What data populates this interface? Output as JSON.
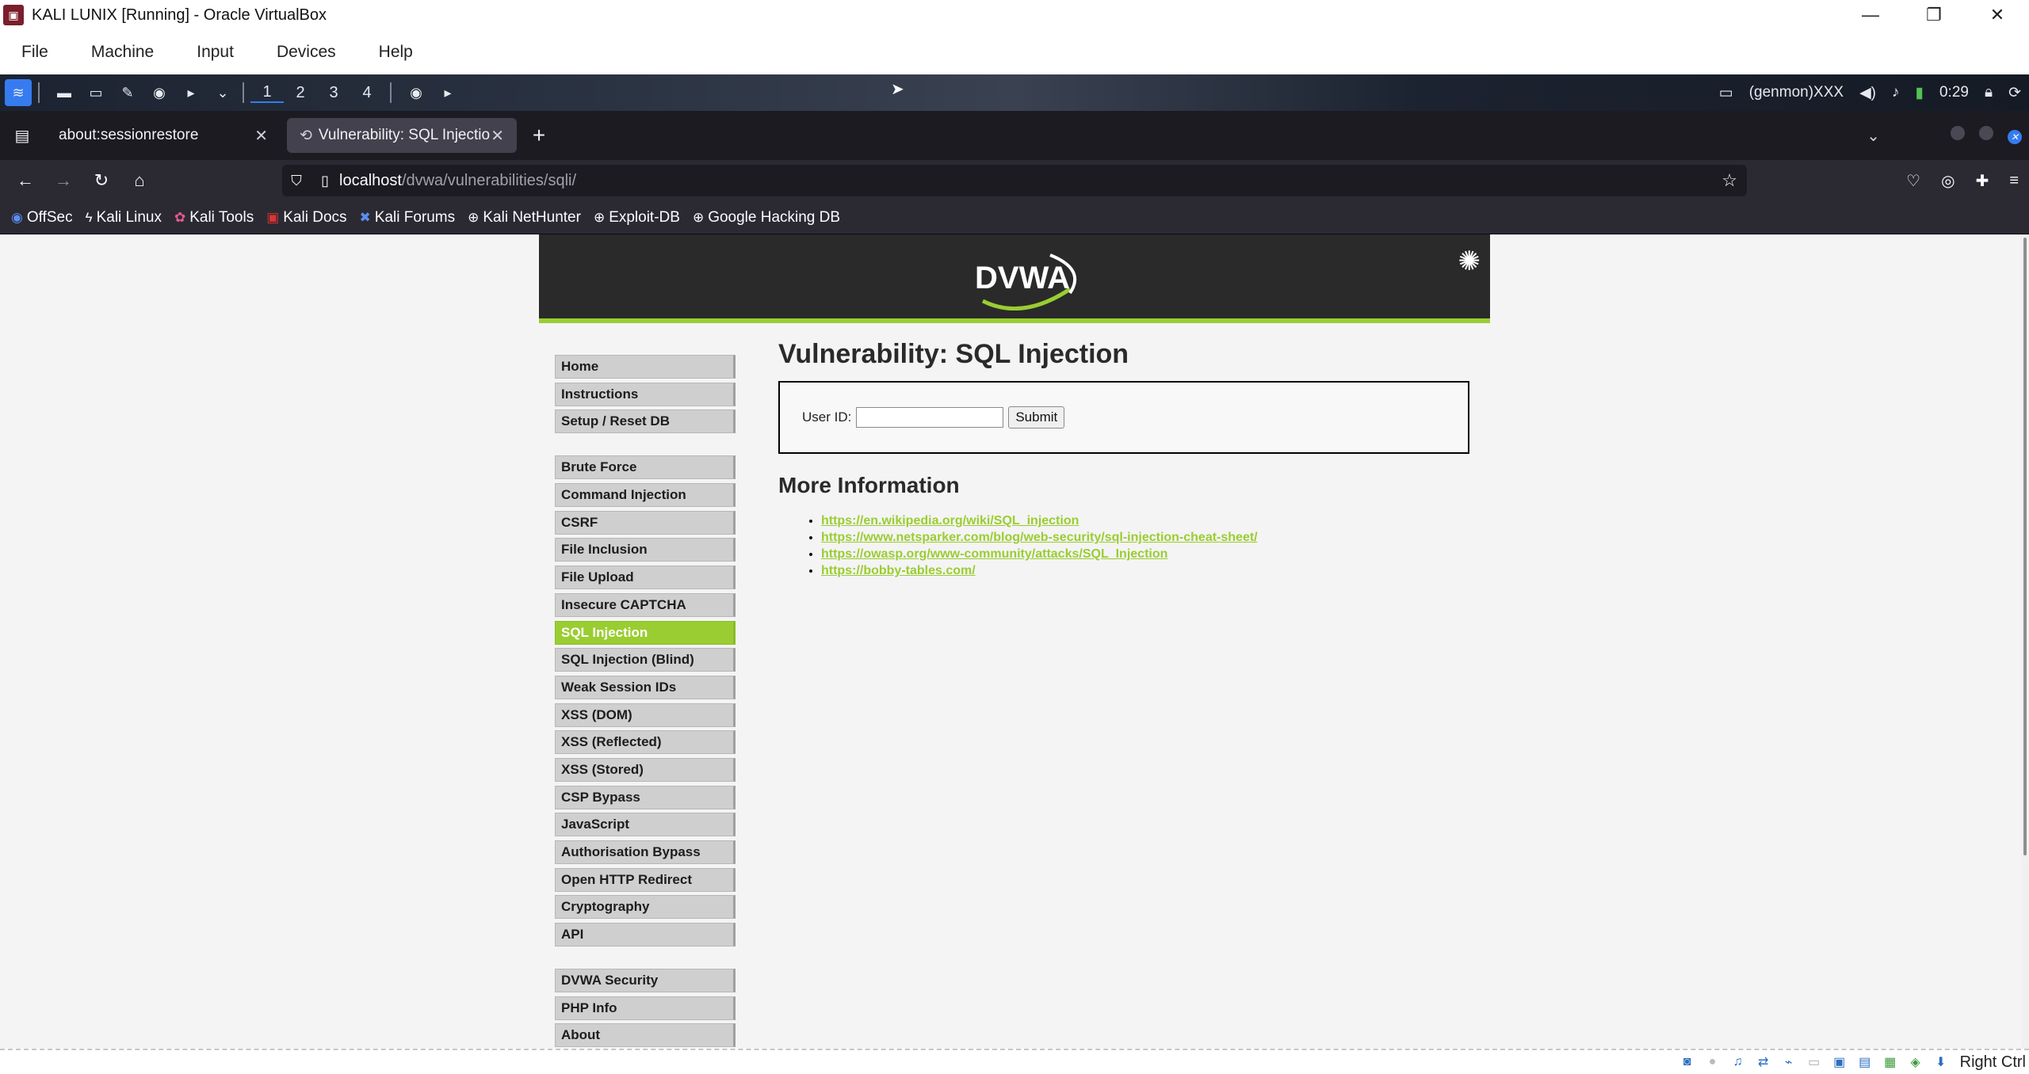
{
  "vbox": {
    "title": "KALI LUNIX [Running] - Oracle VirtualBox",
    "menu": [
      "File",
      "Machine",
      "Input",
      "Devices",
      "Help"
    ],
    "host_key": "Right Ctrl"
  },
  "kali_panel": {
    "workspaces": [
      "1",
      "2",
      "3",
      "4"
    ],
    "genmon": "(genmon)XXX",
    "clock": "0:29"
  },
  "browser": {
    "tabs": [
      {
        "label": "about:sessionrestore",
        "active": false
      },
      {
        "label": "Vulnerability: SQL Injectio",
        "active": true
      }
    ],
    "url_host": "localhost",
    "url_path": "/dvwa/vulnerabilities/sqli/",
    "bookmarks": [
      "OffSec",
      "Kali Linux",
      "Kali Tools",
      "Kali Docs",
      "Kali Forums",
      "Kali NetHunter",
      "Exploit-DB",
      "Google Hacking DB"
    ]
  },
  "dvwa": {
    "logo_text": "DVWA",
    "menu_groups": [
      [
        "Home",
        "Instructions",
        "Setup / Reset DB"
      ],
      [
        "Brute Force",
        "Command Injection",
        "CSRF",
        "File Inclusion",
        "File Upload",
        "Insecure CAPTCHA",
        "SQL Injection",
        "SQL Injection (Blind)",
        "Weak Session IDs",
        "XSS (DOM)",
        "XSS (Reflected)",
        "XSS (Stored)",
        "CSP Bypass",
        "JavaScript",
        "Authorisation Bypass",
        "Open HTTP Redirect",
        "Cryptography",
        "API"
      ],
      [
        "DVWA Security",
        "PHP Info",
        "About"
      ]
    ],
    "selected_item": "SQL Injection",
    "page_title": "Vulnerability: SQL Injection",
    "form": {
      "user_id_label": "User ID:",
      "user_id_value": "",
      "submit_label": "Submit"
    },
    "more_info_title": "More Information",
    "links": [
      "https://en.wikipedia.org/wiki/SQL_injection",
      "https://www.netsparker.com/blog/web-security/sql-injection-cheat-sheet/",
      "https://owasp.org/www-community/attacks/SQL_Injection",
      "https://bobby-tables.com/"
    ],
    "accent_color": "#9acd32"
  }
}
